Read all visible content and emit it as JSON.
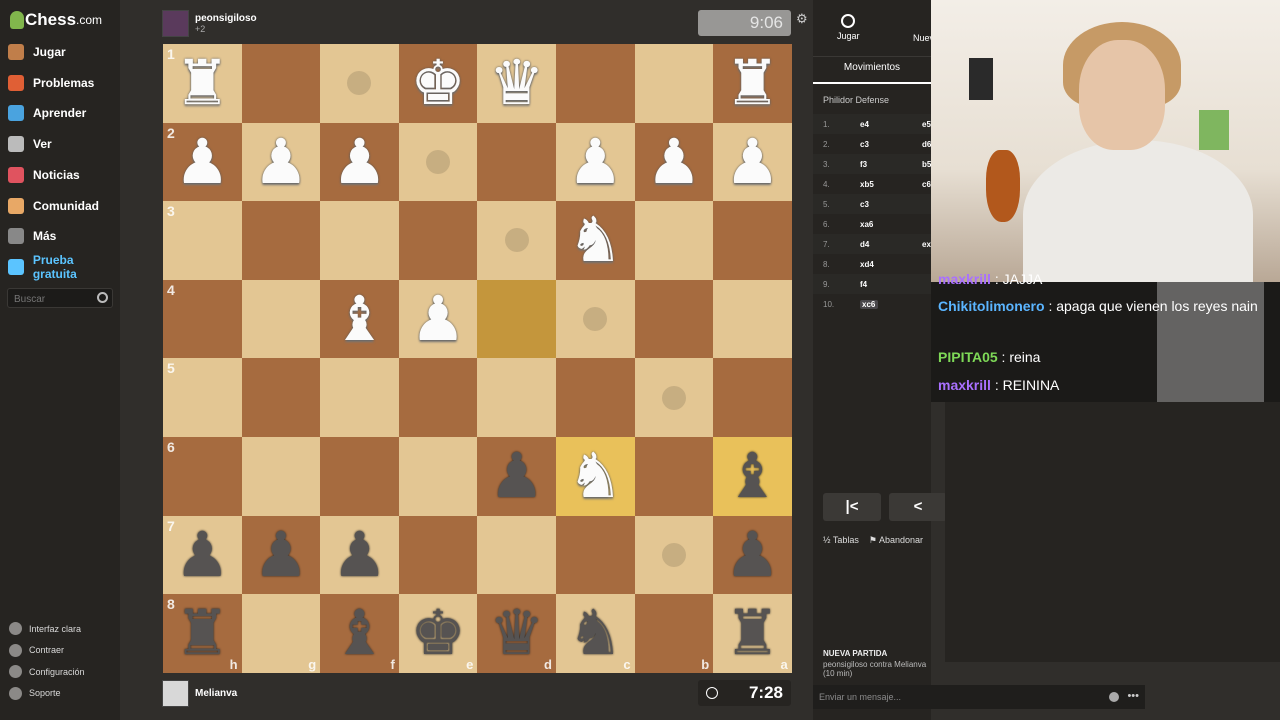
{
  "sidebar": {
    "logo": "Chess",
    "logo_suffix": ".com",
    "items": [
      {
        "label": "Jugar",
        "icon": "play-icon",
        "color": "#c07e4a"
      },
      {
        "label": "Problemas",
        "icon": "puzzle-icon",
        "color": "#e05f35"
      },
      {
        "label": "Aprender",
        "icon": "learn-icon",
        "color": "#4aa3df"
      },
      {
        "label": "Ver",
        "icon": "watch-icon",
        "color": "#bbbbbb"
      },
      {
        "label": "Noticias",
        "icon": "news-icon",
        "color": "#e0535f"
      },
      {
        "label": "Comunidad",
        "icon": "community-icon",
        "color": "#e8a866"
      },
      {
        "label": "Más",
        "icon": "more-icon",
        "color": "#888888"
      },
      {
        "label": "Prueba gratuita",
        "icon": "diamond-icon",
        "color": "#5bc4ff"
      }
    ],
    "search_placeholder": "Buscar",
    "bottom": [
      {
        "label": "Interfaz clara",
        "icon": "theme-icon"
      },
      {
        "label": "Contraer",
        "icon": "collapse-icon"
      },
      {
        "label": "Configuración",
        "icon": "settings-icon"
      },
      {
        "label": "Soporte",
        "icon": "help-icon"
      }
    ]
  },
  "top_player": {
    "name": "peonsigiloso",
    "captured": "+2",
    "clock": "9:06"
  },
  "bottom_player": {
    "name": "Melianva",
    "clock": "7:28"
  },
  "board": {
    "light": "#e3c693",
    "dark": "#a66b3f",
    "ranks": [
      "1",
      "2",
      "3",
      "4",
      "5",
      "6",
      "7",
      "8"
    ],
    "files": [
      "h",
      "g",
      "f",
      "e",
      "d",
      "c",
      "b",
      "a"
    ],
    "rows": [
      [
        "R",
        "",
        "",
        "K",
        "Q",
        "",
        "",
        "R"
      ],
      [
        "P",
        "P",
        "P",
        "",
        "",
        "P",
        "P",
        "P"
      ],
      [
        "",
        "",
        "",
        "",
        "",
        "N",
        "",
        ""
      ],
      [
        "",
        "",
        "B",
        "P",
        "",
        "",
        "",
        ""
      ],
      [
        "",
        "",
        "",
        "",
        "",
        "",
        "",
        ""
      ],
      [
        "",
        "",
        "",
        "",
        "p",
        "N",
        "",
        "b"
      ],
      [
        "p",
        "p",
        "p",
        "",
        "",
        "",
        "",
        "p"
      ],
      [
        "r",
        "",
        "b",
        "k",
        "q",
        "n",
        "",
        "r"
      ]
    ],
    "dots": [
      "1-3",
      "2-4",
      "3-5",
      "4-6",
      "5-7",
      "7-7"
    ],
    "highlights": [
      "4-5",
      "6-6",
      "6-8"
    ]
  },
  "panel": {
    "tab_play": "Jugar",
    "tab_new": "Nuev",
    "tab_moves": "Movimientos",
    "opening": "Philidor Defense",
    "moves": [
      {
        "n": "1.",
        "w": "e4",
        "b": "e5"
      },
      {
        "n": "2.",
        "w": "c3",
        "b": "d6"
      },
      {
        "n": "3.",
        "w": "f3",
        "b": "b5"
      },
      {
        "n": "4.",
        "w": "xb5",
        "b": "c6"
      },
      {
        "n": "5.",
        "w": "c3",
        "b": ""
      },
      {
        "n": "6.",
        "w": "xa6",
        "b": ""
      },
      {
        "n": "7.",
        "w": "d4",
        "b": "ex"
      },
      {
        "n": "8.",
        "w": "xd4",
        "b": ""
      },
      {
        "n": "9.",
        "w": "f4",
        "b": ""
      },
      {
        "n": "10.",
        "w": "xc6",
        "b": ""
      }
    ],
    "draw": "Tablas",
    "resign": "Abandonar",
    "new_game_title": "NUEVA PARTIDA",
    "new_game_desc": "peonsigiloso contra Melianva (10 min)",
    "msg_placeholder": "Enviar un mensaje..."
  },
  "chat": [
    {
      "user": "maxkrill",
      "color": "#a970ff",
      "text": " : JAJJA"
    },
    {
      "user": "Chikitolimonero",
      "color": "#5bb5ff",
      "text": " : apaga que vienen los reyes nain"
    },
    {
      "user": "PIPITA05",
      "color": "#7ed957",
      "text": " : reina"
    },
    {
      "user": "maxkrill",
      "color": "#a970ff",
      "text": " : REININA"
    }
  ]
}
